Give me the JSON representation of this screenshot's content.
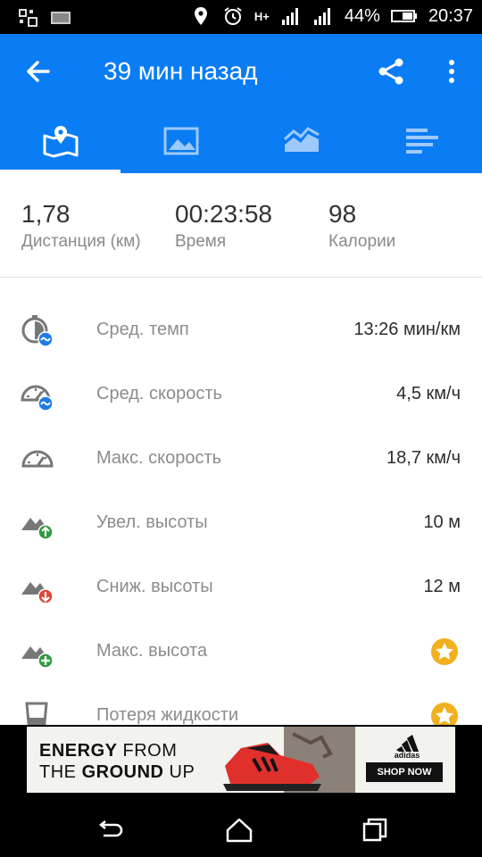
{
  "status_bar": {
    "battery": "44%",
    "time": "20:37",
    "network": "H+"
  },
  "app_bar": {
    "title": "39 мин назад"
  },
  "tabs": [
    {
      "icon": "map-icon",
      "active": true
    },
    {
      "icon": "photo-icon",
      "active": false
    },
    {
      "icon": "chart-icon",
      "active": false
    },
    {
      "icon": "splits-icon",
      "active": false
    }
  ],
  "summary": [
    {
      "value": "1,78",
      "label": "Дистанция (км)"
    },
    {
      "value": "00:23:58",
      "label": "Время"
    },
    {
      "value": "98",
      "label": "Калории"
    }
  ],
  "stats": [
    {
      "icon": "avg-pace-icon",
      "label": "Сред. темп",
      "value": "13:26 мин/км"
    },
    {
      "icon": "avg-speed-icon",
      "label": "Сред. скорость",
      "value": "4,5 км/ч"
    },
    {
      "icon": "max-speed-icon",
      "label": "Макс. скорость",
      "value": "18,7 км/ч"
    },
    {
      "icon": "elevation-gain-icon",
      "label": "Увел. высоты",
      "value": "10 м"
    },
    {
      "icon": "elevation-loss-icon",
      "label": "Сниж. высоты",
      "value": "12 м"
    },
    {
      "icon": "max-altitude-icon",
      "label": "Макс. высота",
      "value": "",
      "premium": true
    },
    {
      "icon": "fluid-loss-icon",
      "label": "Потеря жидкости",
      "value": "",
      "premium": true
    }
  ],
  "ad": {
    "line1_bold": "ENERGY",
    "line1_rest": " FROM",
    "line2_pre": "THE ",
    "line2_bold": "GROUND",
    "line2_rest": " UP",
    "brand": "adidas",
    "cta": "SHOP NOW"
  },
  "colors": {
    "primary": "#0a7cf4",
    "star": "#f2b01e",
    "up_arrow": "#2e9a3c",
    "down_arrow": "#e0453a"
  }
}
